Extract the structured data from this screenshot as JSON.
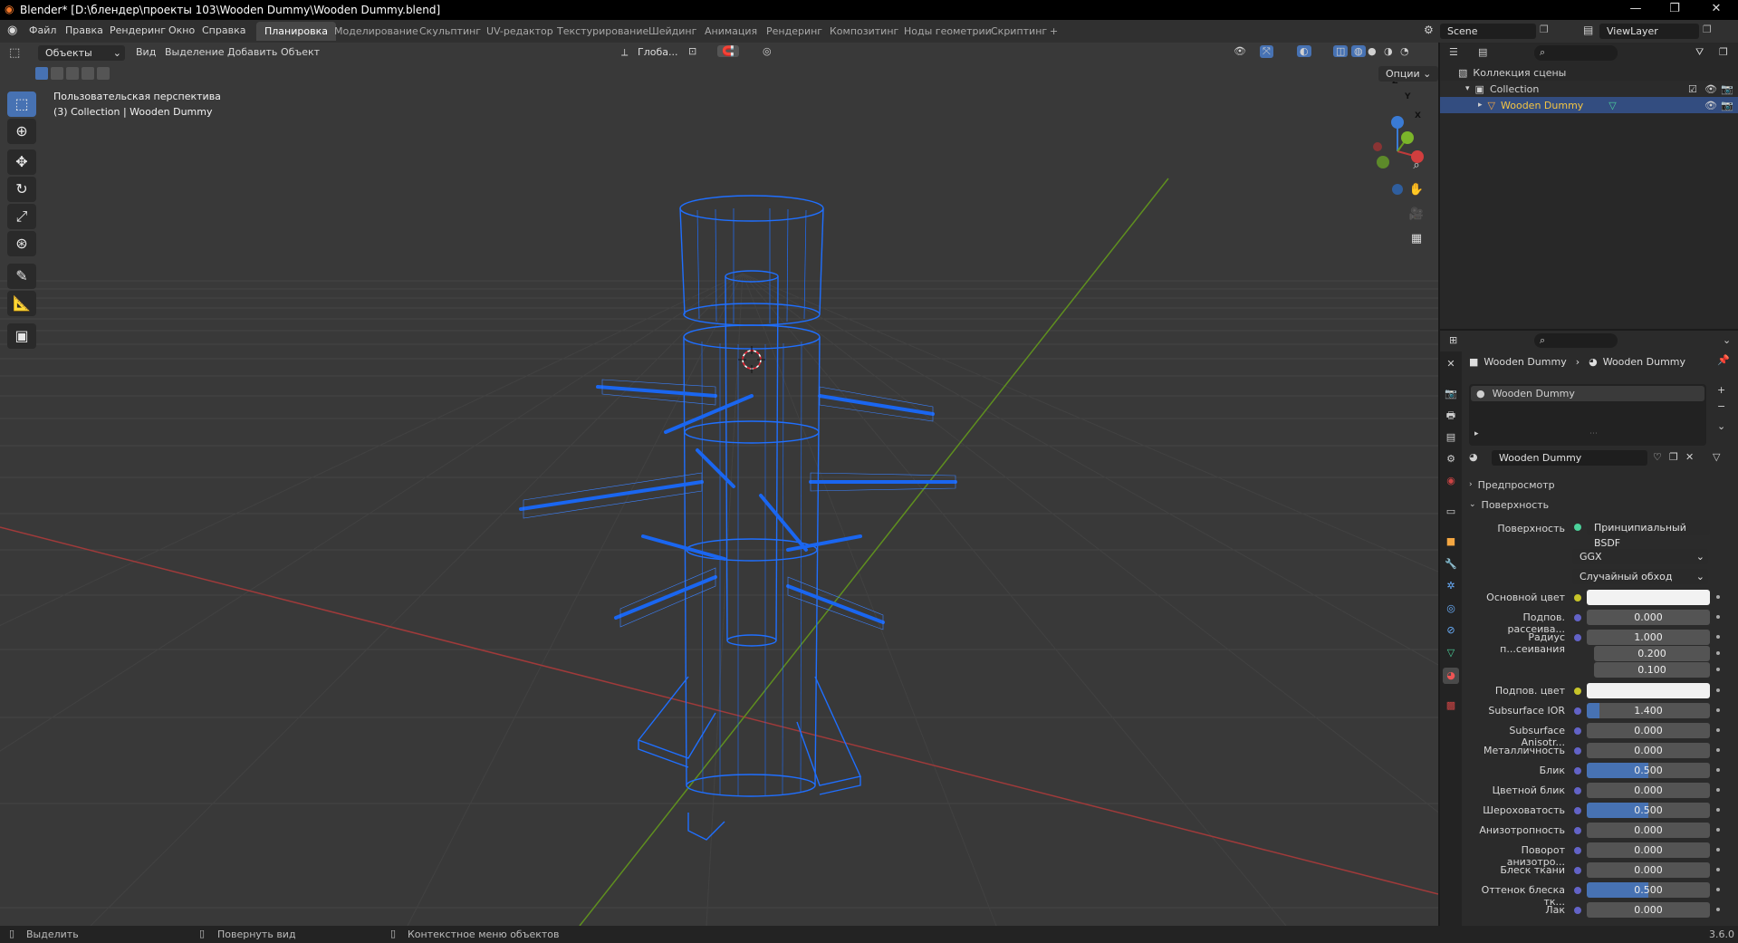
{
  "window": {
    "title": "Blender* [D:\\блендер\\проекты 103\\Wooden Dummy\\Wooden Dummy.blend]",
    "min_label": "—",
    "max_label": "❐",
    "close_label": "✕"
  },
  "menu": {
    "items": [
      "Файл",
      "Правка",
      "Рендеринг",
      "Окно",
      "Справка"
    ]
  },
  "workspaces": [
    "Планировка",
    "Моделирование",
    "Скульптинг",
    "UV-редактор",
    "Текстурирование",
    "Шейдинг",
    "Анимация",
    "Рендеринг",
    "Композитинг",
    "Ноды геометрии",
    "Скриптинг"
  ],
  "active_workspace": "Планировка",
  "add_tab": "+",
  "scene": {
    "name": "Scene",
    "view_layer": "ViewLayer"
  },
  "viewport": {
    "mode": "Объекты",
    "menus": [
      "Вид",
      "Выделение",
      "Добавить",
      "Объект"
    ],
    "transform_orientation": "Глоба...",
    "options_label": "Опции",
    "perspective": "Пользовательская перспектива",
    "collection_info": "(3) Collection | Wooden Dummy",
    "gizmo": {
      "z": "Z",
      "y": "Y",
      "x": "X"
    }
  },
  "outliner": {
    "rows": [
      {
        "label": "Коллекция сцены"
      },
      {
        "label": "Collection"
      },
      {
        "label": "Wooden Dummy"
      }
    ]
  },
  "properties": {
    "breadcrumb": [
      "Wooden Dummy",
      "Wooden Dummy"
    ],
    "slot": "Wooden Dummy",
    "material_name": "Wooden Dummy",
    "sections": {
      "preview": "Предпросмотр",
      "surface": "Поверхность"
    },
    "surface_label": "Поверхность",
    "surface_value": "Принципиальный BSDF",
    "distribution": "GGX",
    "subsurface_method": "Случайный обход",
    "fields": [
      {
        "label": "Основной цвет",
        "value": "",
        "kind": "color"
      },
      {
        "label": "Подпов. рассеива...",
        "value": "0.000",
        "fill": 0
      },
      {
        "label": "Радиус п...сеивания",
        "value": "1.000",
        "fill": 0
      },
      {
        "label": "",
        "value": "0.200",
        "fill": 0
      },
      {
        "label": "",
        "value": "0.100",
        "fill": 0
      },
      {
        "label": "Подпов. цвет",
        "value": "",
        "kind": "color"
      },
      {
        "label": "Subsurface IOR",
        "value": "1.400",
        "fill": 0.1
      },
      {
        "label": "Subsurface Anisotr...",
        "value": "0.000",
        "fill": 0
      },
      {
        "label": "Металличность",
        "value": "0.000",
        "fill": 0
      },
      {
        "label": "Блик",
        "value": "0.500",
        "fill": 0.5
      },
      {
        "label": "Цветной блик",
        "value": "0.000",
        "fill": 0
      },
      {
        "label": "Шероховатость",
        "value": "0.500",
        "fill": 0.5
      },
      {
        "label": "Анизотропность",
        "value": "0.000",
        "fill": 0
      },
      {
        "label": "Поворот анизотро...",
        "value": "0.000",
        "fill": 0
      },
      {
        "label": "Блеск ткани",
        "value": "0.000",
        "fill": 0
      },
      {
        "label": "Оттенок блеска тк...",
        "value": "0.500",
        "fill": 0.5
      },
      {
        "label": "Лак",
        "value": "0.000",
        "fill": 0
      }
    ]
  },
  "statusbar": {
    "select": "Выделить",
    "rotate": "Повернуть вид",
    "context": "Контекстное меню объектов",
    "version": "3.6.0"
  },
  "colors": {
    "accent": "#4772b3",
    "wire": "#1f6fff",
    "x_axis": "#b03a3a",
    "y_axis": "#6a9a22"
  }
}
